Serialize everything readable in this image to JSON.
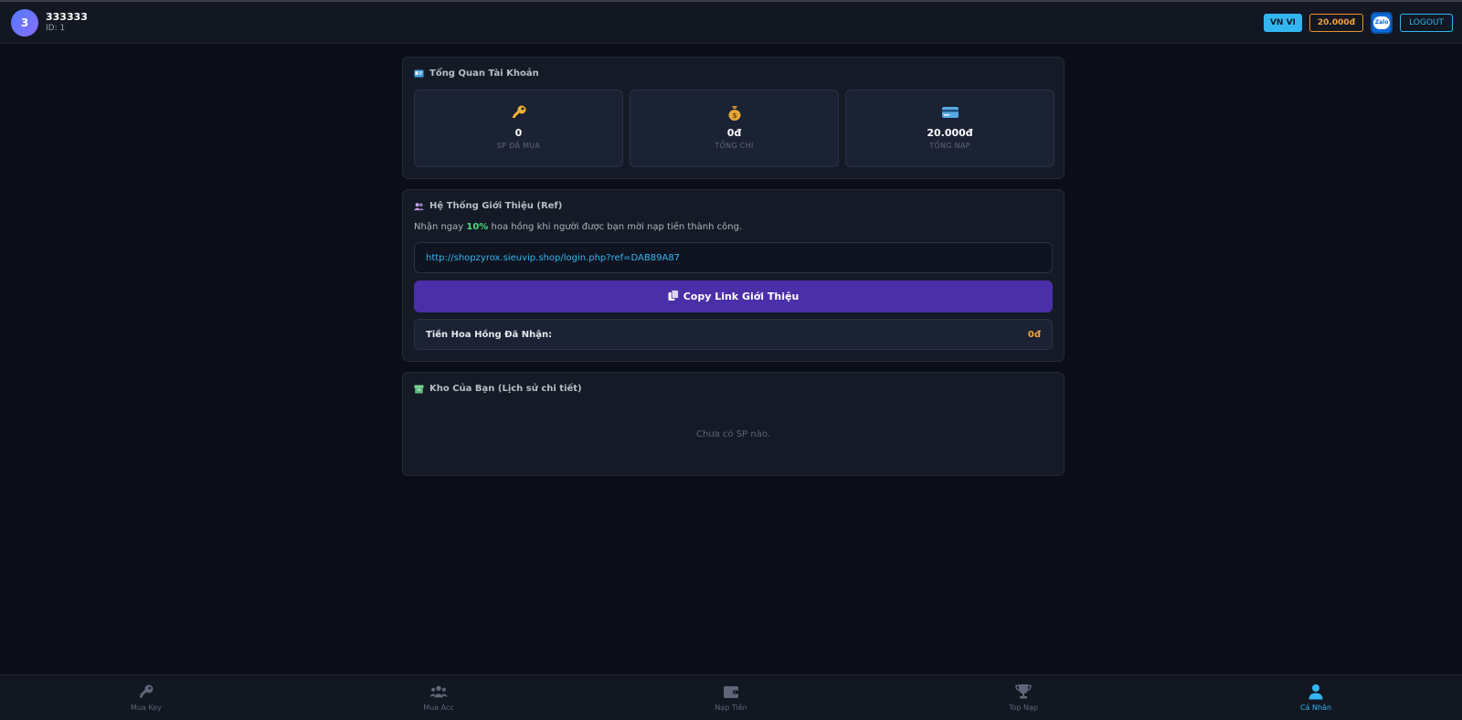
{
  "header": {
    "avatar_letter": "3",
    "username": "333333",
    "user_id": "ID: 1",
    "lang_label": "VN VI",
    "balance_label": "20.000đ",
    "zalo_label": "Zalo",
    "logout_label": "LOGOUT"
  },
  "overview": {
    "title": "Tổng Quan Tài Khoản",
    "stats": [
      {
        "icon": "key-icon",
        "value": "0",
        "label": "SP ĐÃ MUA"
      },
      {
        "icon": "money-bag-icon",
        "value": "0đ",
        "label": "TỔNG CHI"
      },
      {
        "icon": "credit-card-icon",
        "value": "20.000đ",
        "label": "TỔNG NẠP"
      }
    ]
  },
  "referral": {
    "title": "Hệ Thống Giới Thiệu (Ref)",
    "desc_before": "Nhận ngay ",
    "desc_highlight": "10%",
    "desc_after": " hoa hồng khi người được bạn mời nạp tiền thành công.",
    "link": "http://shopzyrox.sieuvip.shop/login.php?ref=DAB89A87",
    "copy_label": "Copy Link Giới Thiệu",
    "commission_label": "Tiền Hoa Hồng Đã Nhận:",
    "commission_value": "0đ"
  },
  "inventory": {
    "title": "Kho Của Bạn (Lịch sử chi tiết)",
    "empty_text": "Chưa có SP nào."
  },
  "bottom_nav": [
    {
      "label": "Mua Key",
      "icon": "key-icon",
      "active": false
    },
    {
      "label": "Mua Acc",
      "icon": "users-icon",
      "active": false
    },
    {
      "label": "Nạp Tiền",
      "icon": "wallet-icon",
      "active": false
    },
    {
      "label": "Top Nạp",
      "icon": "trophy-icon",
      "active": false
    },
    {
      "label": "Cá Nhân",
      "icon": "user-icon",
      "active": true
    }
  ],
  "colors": {
    "accent": "#33b6f0",
    "purple_button": "#4a2fa8",
    "orange": "#f0a33e",
    "green": "#4cd97a"
  }
}
